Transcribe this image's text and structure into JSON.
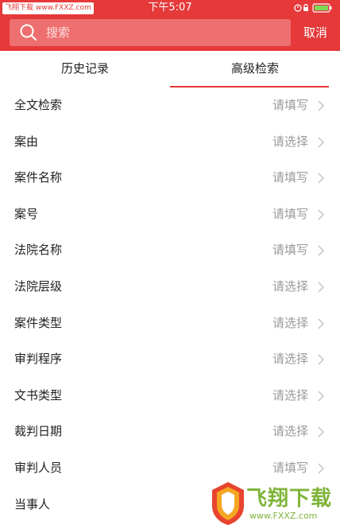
{
  "status_bar": {
    "site_badge": "飞翔下载 www.FXXZ.com",
    "time": "下午5:07"
  },
  "search": {
    "placeholder": "搜索",
    "cancel_label": "取消"
  },
  "tabs": [
    {
      "label": "历史记录",
      "active": false
    },
    {
      "label": "高级检索",
      "active": true
    }
  ],
  "fields": [
    {
      "label": "全文检索",
      "placeholder": "请填写"
    },
    {
      "label": "案由",
      "placeholder": "请选择"
    },
    {
      "label": "案件名称",
      "placeholder": "请填写"
    },
    {
      "label": "案号",
      "placeholder": "请填写"
    },
    {
      "label": "法院名称",
      "placeholder": "请填写"
    },
    {
      "label": "法院层级",
      "placeholder": "请选择"
    },
    {
      "label": "案件类型",
      "placeholder": "请选择"
    },
    {
      "label": "审判程序",
      "placeholder": "请选择"
    },
    {
      "label": "文书类型",
      "placeholder": "请选择"
    },
    {
      "label": "裁判日期",
      "placeholder": "请选择"
    },
    {
      "label": "审判人员",
      "placeholder": "请填写"
    },
    {
      "label": "当事人",
      "placeholder": ""
    }
  ],
  "watermark": {
    "brand": "飞翔下载",
    "url": "www.FXXZ.com"
  },
  "colors": {
    "brand_red": "#e5393a",
    "placeholder_gray": "#9a9a9a",
    "watermark_green": "#7fb43a"
  },
  "icons": [
    "search-icon",
    "chevron-right-icon",
    "lock-icon",
    "alarm-icon",
    "battery-icon"
  ]
}
